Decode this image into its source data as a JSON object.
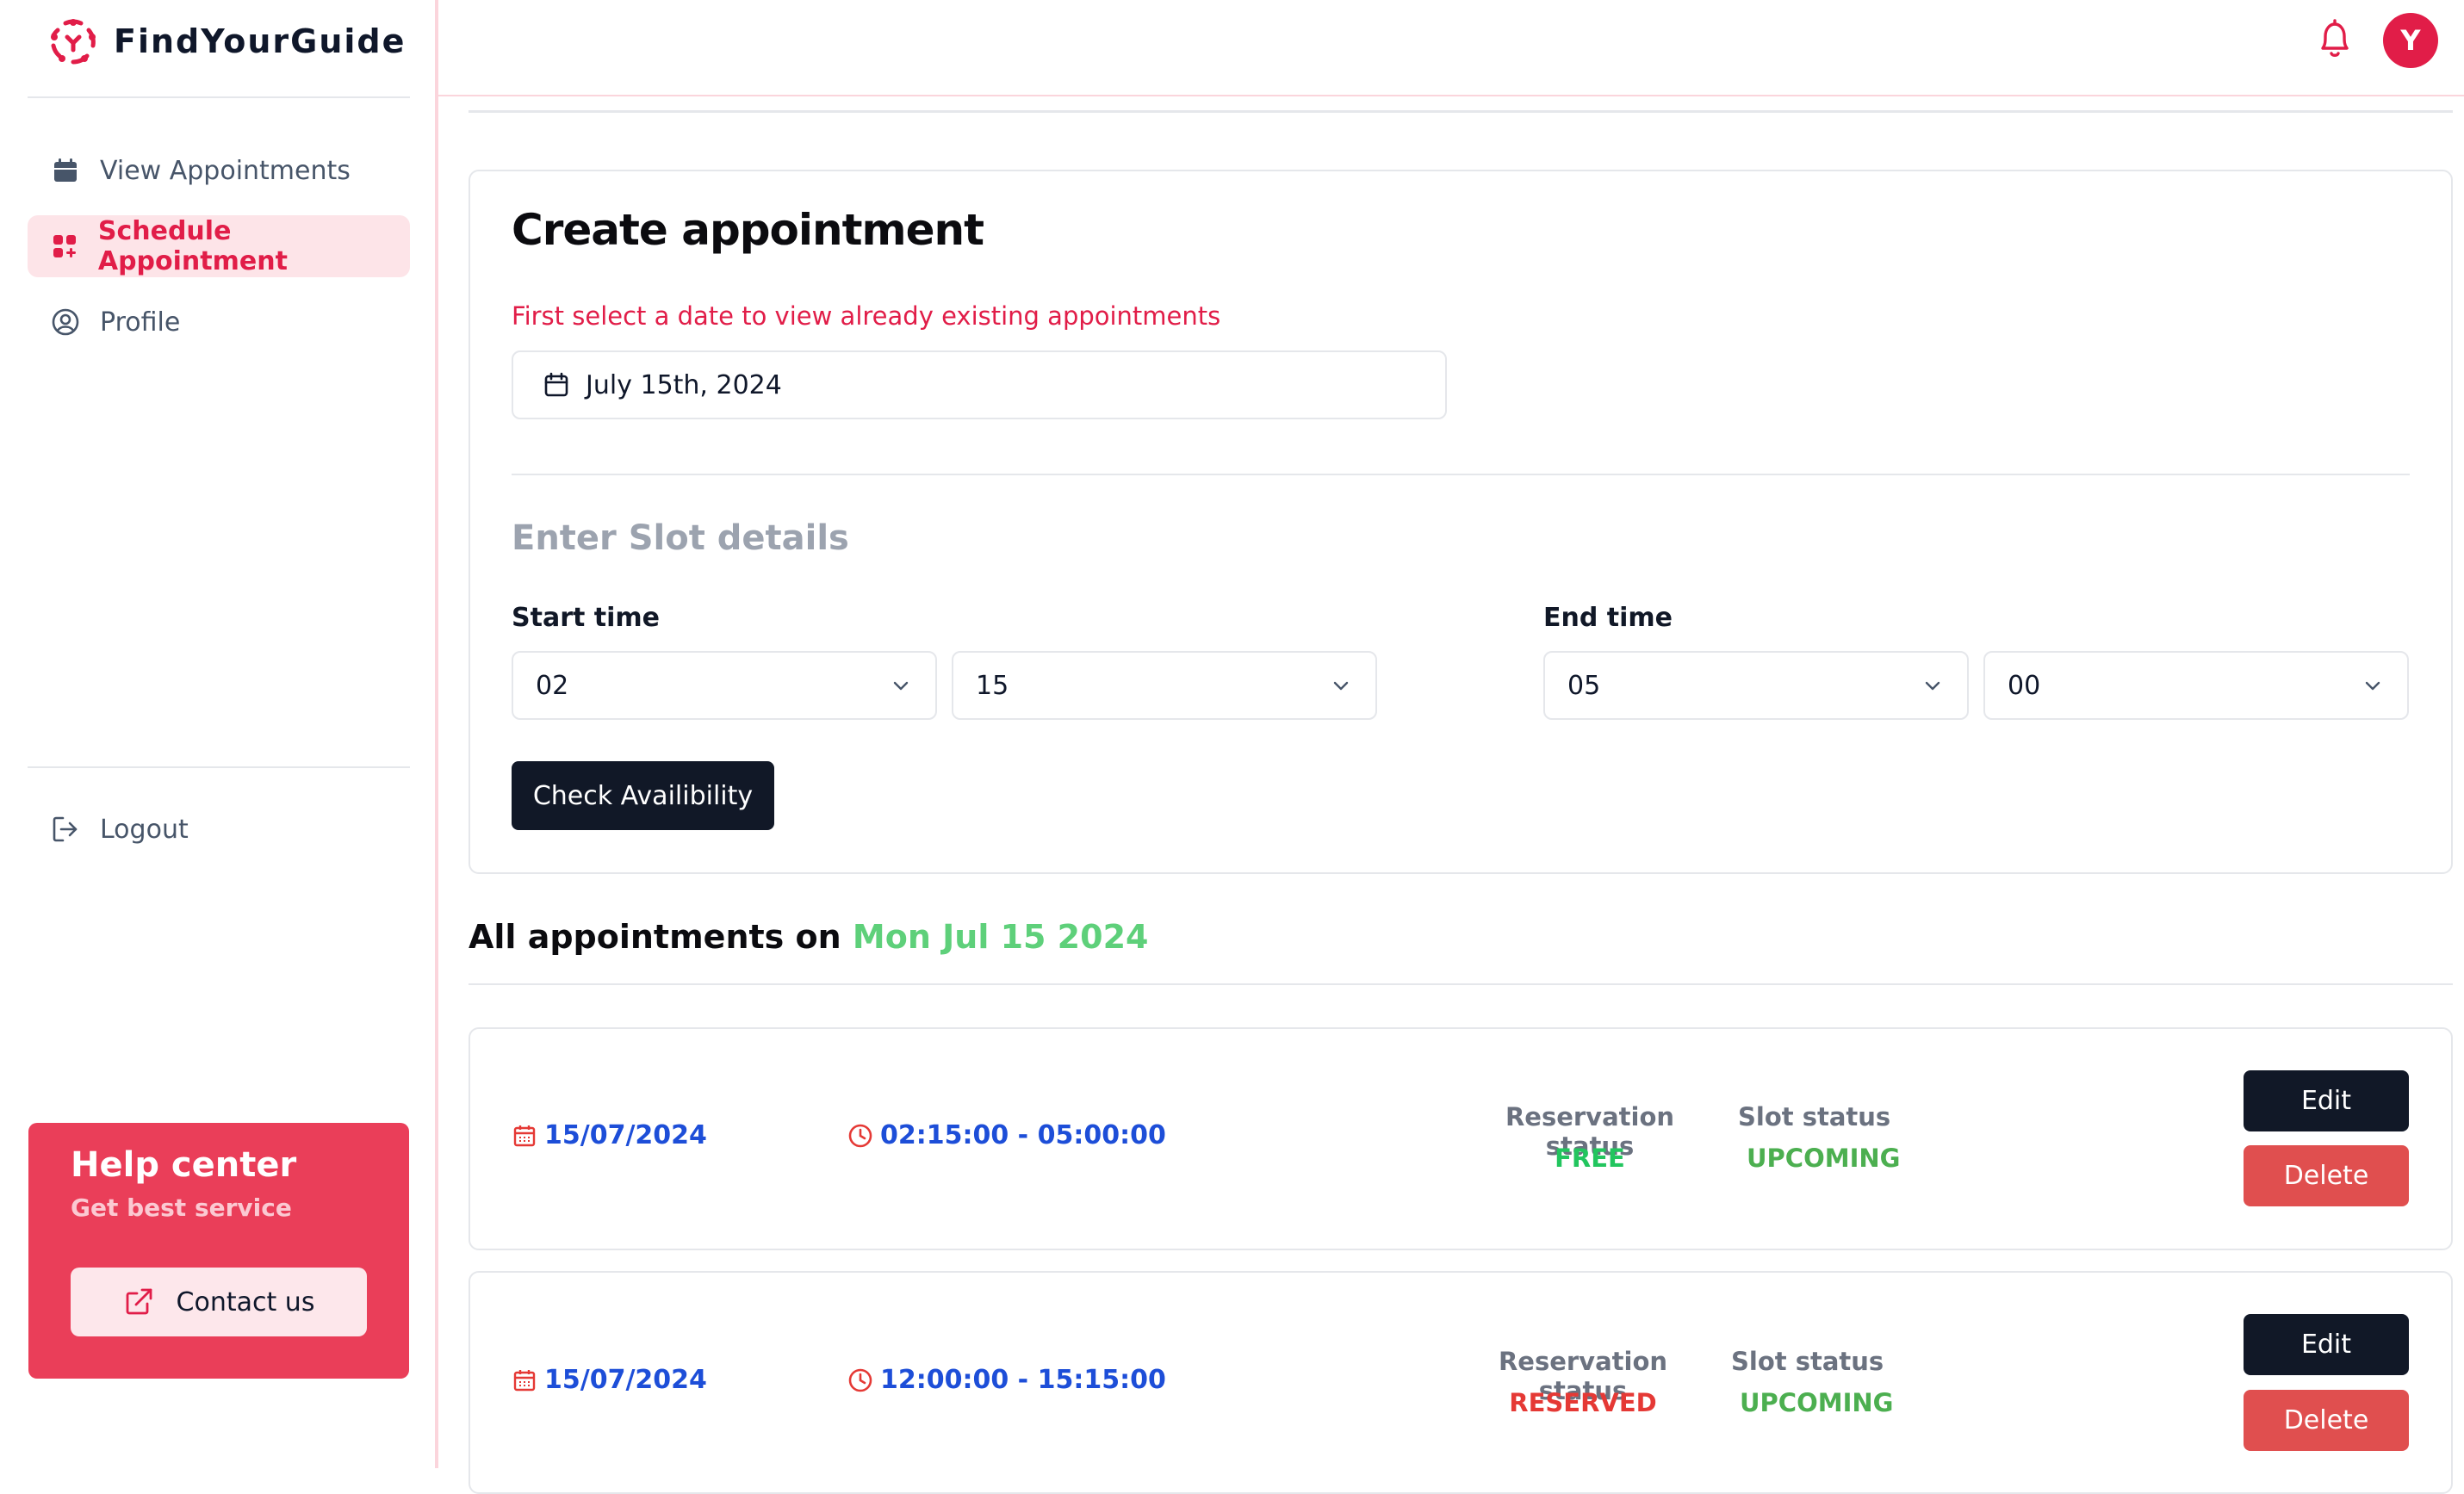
{
  "app": {
    "name": "FindYourGuide",
    "user_initial": "Y"
  },
  "sidebar": {
    "items": [
      {
        "label": "View Appointments",
        "icon": "calendar-icon"
      },
      {
        "label": "Schedule Appointment",
        "icon": "grid-plus-icon",
        "active": true
      },
      {
        "label": "Profile",
        "icon": "user-circle-icon"
      }
    ],
    "logout_label": "Logout",
    "help": {
      "title": "Help center",
      "subtitle": "Get best service",
      "button": "Contact us"
    }
  },
  "create": {
    "title": "Create appointment",
    "hint": "First select a date to view already existing appointments",
    "date_value": "July 15th, 2024",
    "slot_title": "Enter Slot details",
    "start_label": "Start time",
    "end_label": "End time",
    "start_hour": "02",
    "start_minute": "15",
    "end_hour": "05",
    "end_minute": "00",
    "check_button": "Check Availibility"
  },
  "list": {
    "heading_prefix": "All appointments on",
    "heading_date": "Mon Jul 15 2024",
    "reservation_label": "Reservation status",
    "slot_label": "Slot status",
    "edit_label": "Edit",
    "delete_label": "Delete",
    "appointments": [
      {
        "date": "15/07/2024",
        "time": "02:15:00 - 05:00:00",
        "reservation": "FREE",
        "slot": "UPCOMING"
      },
      {
        "date": "15/07/2024",
        "time": "12:00:00 - 15:15:00",
        "reservation": "RESERVED",
        "slot": "UPCOMING"
      }
    ]
  },
  "colors": {
    "brand": "#e11d48",
    "free": "#22c55e",
    "reserved": "#e53935",
    "upcoming": "#4caf50",
    "date_blue": "#1d4ed8",
    "highlight_green": "#5ed07a"
  }
}
